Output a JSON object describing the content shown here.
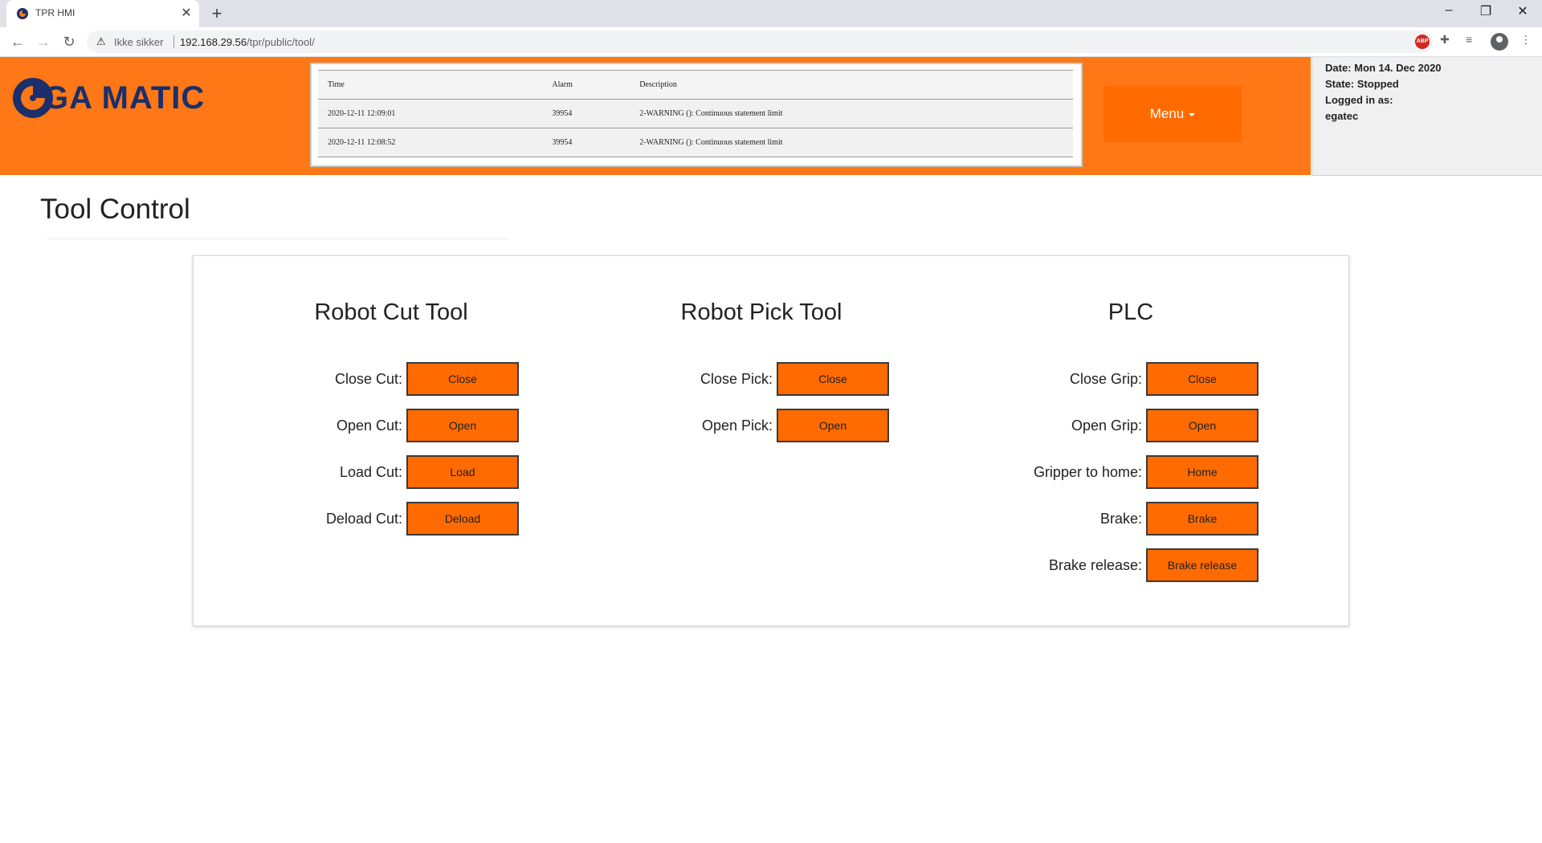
{
  "browser": {
    "tab_title": "TPR HMI",
    "tab_close": "✕",
    "new_tab": "+",
    "security_label": "Ikke sikker",
    "url_host": "192.168.29.56",
    "url_path": "/tpr/public/tool/",
    "extension_badge": "ABP"
  },
  "header": {
    "logo_text": "EGA MATIC",
    "menu_label": "Menu",
    "brand_color": "#ff7716"
  },
  "alarms": {
    "headers": [
      "Time",
      "Alarm",
      "Description"
    ],
    "rows": [
      [
        "2020-12-11 12:09:01",
        "39954",
        "2-WARNING (): Continuous statement limit"
      ],
      [
        "2020-12-11 12:08:52",
        "39954",
        "2-WARNING (): Continuous statement limit"
      ]
    ]
  },
  "status": {
    "date_label": "Date:",
    "date_value": "Mon 14. Dec 2020",
    "state_label": "State:",
    "state_value": "Stopped",
    "logged_label": "Logged in as:",
    "user": "egatec"
  },
  "page": {
    "title": "Tool Control"
  },
  "cut_tool": {
    "title": "Robot Cut Tool",
    "rows": [
      {
        "label": "Close Cut:",
        "button": "Close"
      },
      {
        "label": "Open Cut:",
        "button": "Open"
      },
      {
        "label": "Load Cut:",
        "button": "Load"
      },
      {
        "label": "Deload Cut:",
        "button": "Deload"
      }
    ]
  },
  "pick_tool": {
    "title": "Robot Pick Tool",
    "rows": [
      {
        "label": "Close Pick:",
        "button": "Close"
      },
      {
        "label": "Open Pick:",
        "button": "Open"
      }
    ]
  },
  "plc": {
    "title": "PLC",
    "rows": [
      {
        "label": "Close Grip:",
        "button": "Close"
      },
      {
        "label": "Open Grip:",
        "button": "Open"
      },
      {
        "label": "Gripper to home:",
        "button": "Home"
      },
      {
        "label": "Brake:",
        "button": "Brake"
      },
      {
        "label": "Brake release:",
        "button": "Brake release"
      }
    ]
  }
}
